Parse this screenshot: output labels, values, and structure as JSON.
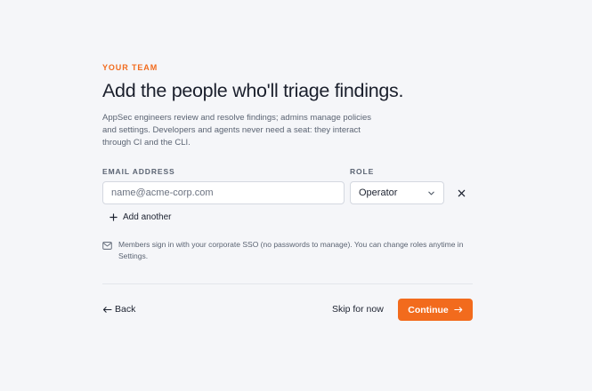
{
  "header": {
    "eyebrow": "YOUR TEAM",
    "title": "Add the people who'll triage findings.",
    "description": "AppSec engineers review and resolve findings; admins manage policies and settings. Developers and agents never need a seat: they interact through CI and the CLI."
  },
  "form": {
    "email_label": "EMAIL ADDRESS",
    "role_label": "ROLE",
    "email_placeholder": "name@acme-corp.com",
    "email_value": "",
    "role_value": "Operator",
    "add_another_label": "Add another"
  },
  "note": {
    "text": "Members sign in with your corporate SSO (no passwords to manage). You can change roles anytime in Settings."
  },
  "footer": {
    "back_label": "Back",
    "skip_label": "Skip for now",
    "continue_label": "Continue"
  },
  "colors": {
    "accent": "#f26b1d",
    "background": "#f5f6f9"
  },
  "icons": {
    "role_chevron": "chevron-down-icon",
    "remove_row": "close-icon",
    "add_another": "plus-icon",
    "note": "mail-icon",
    "back": "arrow-left-icon",
    "continue": "arrow-right-icon"
  }
}
